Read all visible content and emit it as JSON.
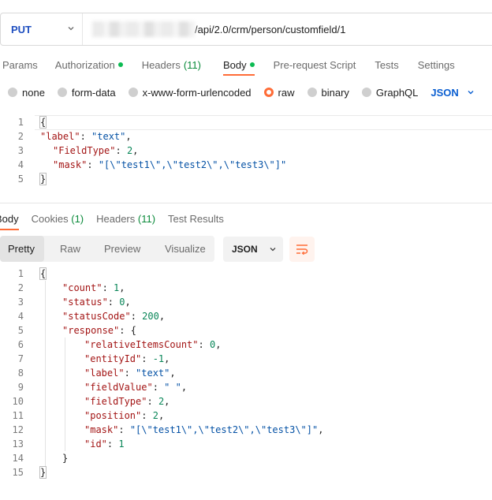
{
  "request": {
    "method": "PUT",
    "url_visible": "/api/2.0/crm/person/customfield/1"
  },
  "tabs": [
    {
      "label": "Params"
    },
    {
      "label": "Authorization",
      "dot": true
    },
    {
      "label": "Headers",
      "count": "(11)"
    },
    {
      "label": "Body",
      "dot": true,
      "active": true
    },
    {
      "label": "Pre-request Script"
    },
    {
      "label": "Tests"
    },
    {
      "label": "Settings"
    }
  ],
  "body_types": [
    "none",
    "form-data",
    "x-www-form-urlencoded",
    "raw",
    "binary",
    "GraphQL"
  ],
  "body_type_selected": "raw",
  "body_format": "JSON",
  "request_body_lines": [
    "{",
    "\"label\": \"text\",",
    "\"FieldType\": 2,",
    "\"mask\": \"[\\\"test1\\\",\\\"test2\\\",\\\"test3\\\"]\"",
    "}"
  ],
  "request_line_numbers": [
    "1",
    "2",
    "3",
    "4",
    "5"
  ],
  "response_tabs": [
    {
      "label": "Body",
      "active": true
    },
    {
      "label": "Cookies",
      "count": "(1)"
    },
    {
      "label": "Headers",
      "count": "(11)"
    },
    {
      "label": "Test Results"
    }
  ],
  "view_modes": [
    "Pretty",
    "Raw",
    "Preview",
    "Visualize"
  ],
  "view_mode_selected": "Pretty",
  "response_format": "JSON",
  "response_line_numbers": [
    "1",
    "2",
    "3",
    "4",
    "5",
    "6",
    "7",
    "8",
    "9",
    "10",
    "11",
    "12",
    "13",
    "14",
    "15"
  ],
  "response": {
    "count": 1,
    "status": 0,
    "statusCode": 200,
    "relativeItemsCount": 0,
    "entityId": -1,
    "label": "text",
    "fieldValue": " ",
    "fieldType": 2,
    "position": 2,
    "mask": "[\\\"test1\\\",\\\"test2\\\",\\\"test3\\\"]",
    "id": 1
  },
  "colors": {
    "accent": "#ff6c37",
    "method": "#1f4fc0",
    "dot": "#0cbb52",
    "json_key": "#a31515",
    "json_string": "#0451a5",
    "json_number": "#098658"
  },
  "icons": [
    "chevron-down-icon",
    "wrap-lines-icon"
  ]
}
